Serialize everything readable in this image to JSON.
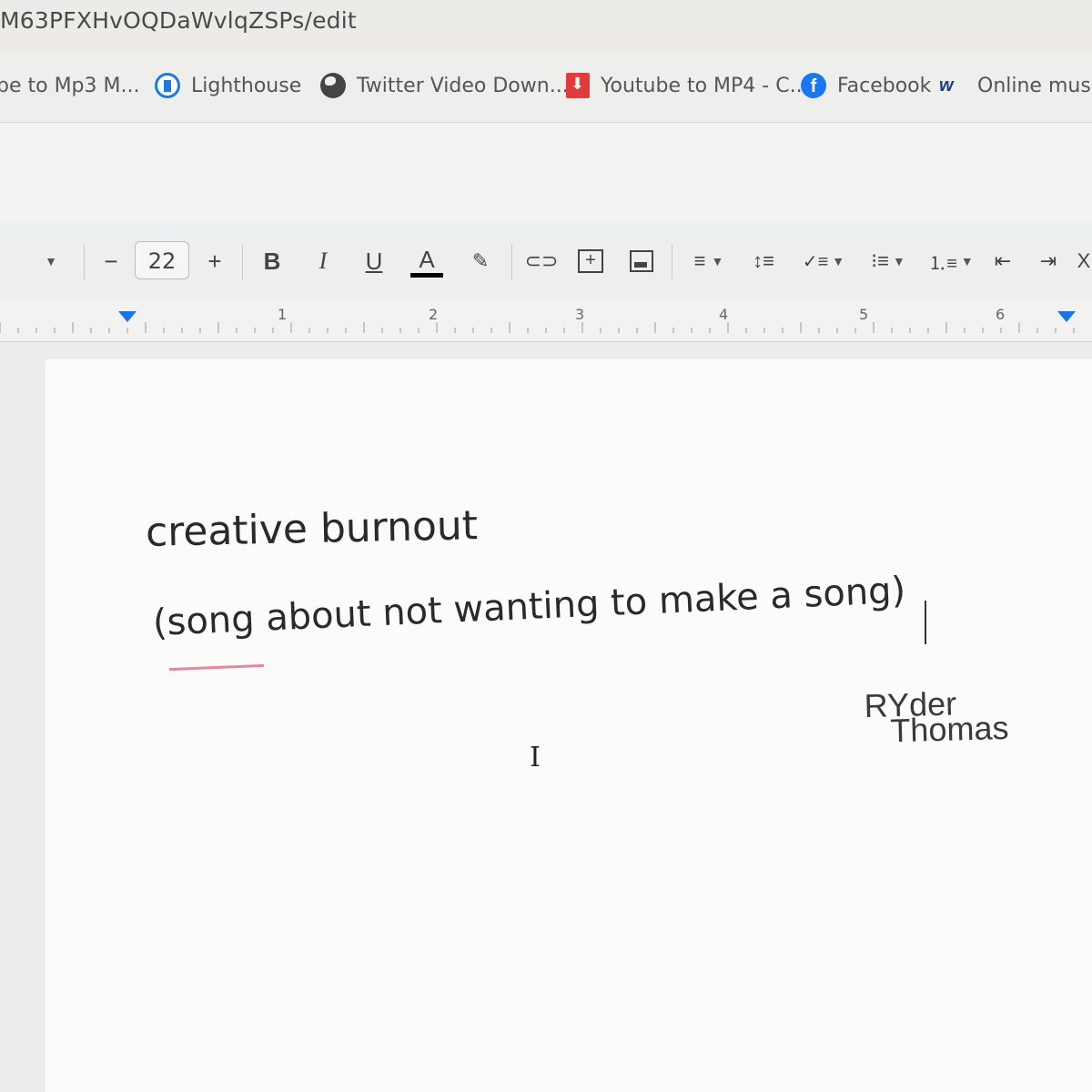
{
  "url": "M63PFXHvOQDaWvlqZSPs/edit",
  "bookmarks": [
    {
      "label": "pe to Mp3 M...",
      "icon": "none"
    },
    {
      "label": "Lighthouse",
      "icon": "lighthouse-icon"
    },
    {
      "label": "Twitter Video Down...",
      "icon": "globe-icon"
    },
    {
      "label": "Youtube to MP4 - C...",
      "icon": "download-icon"
    },
    {
      "label": "Facebook",
      "icon": "facebook-icon"
    },
    {
      "label": "Online music/v",
      "icon": "mw-icon"
    }
  ],
  "toolbar": {
    "font_size": "22",
    "minus": "−",
    "plus": "+",
    "bold": "B",
    "italic": "I",
    "underline": "U",
    "text_color": "A",
    "text_color_value": "#000000"
  },
  "ruler": {
    "numbers": [
      "1",
      "2",
      "3",
      "4",
      "5",
      "6"
    ]
  },
  "document": {
    "title": "creative burnout",
    "subtitle": "(song about not wanting to make a song)",
    "signature_line1": "RYder",
    "signature_line2": "Thomas"
  }
}
